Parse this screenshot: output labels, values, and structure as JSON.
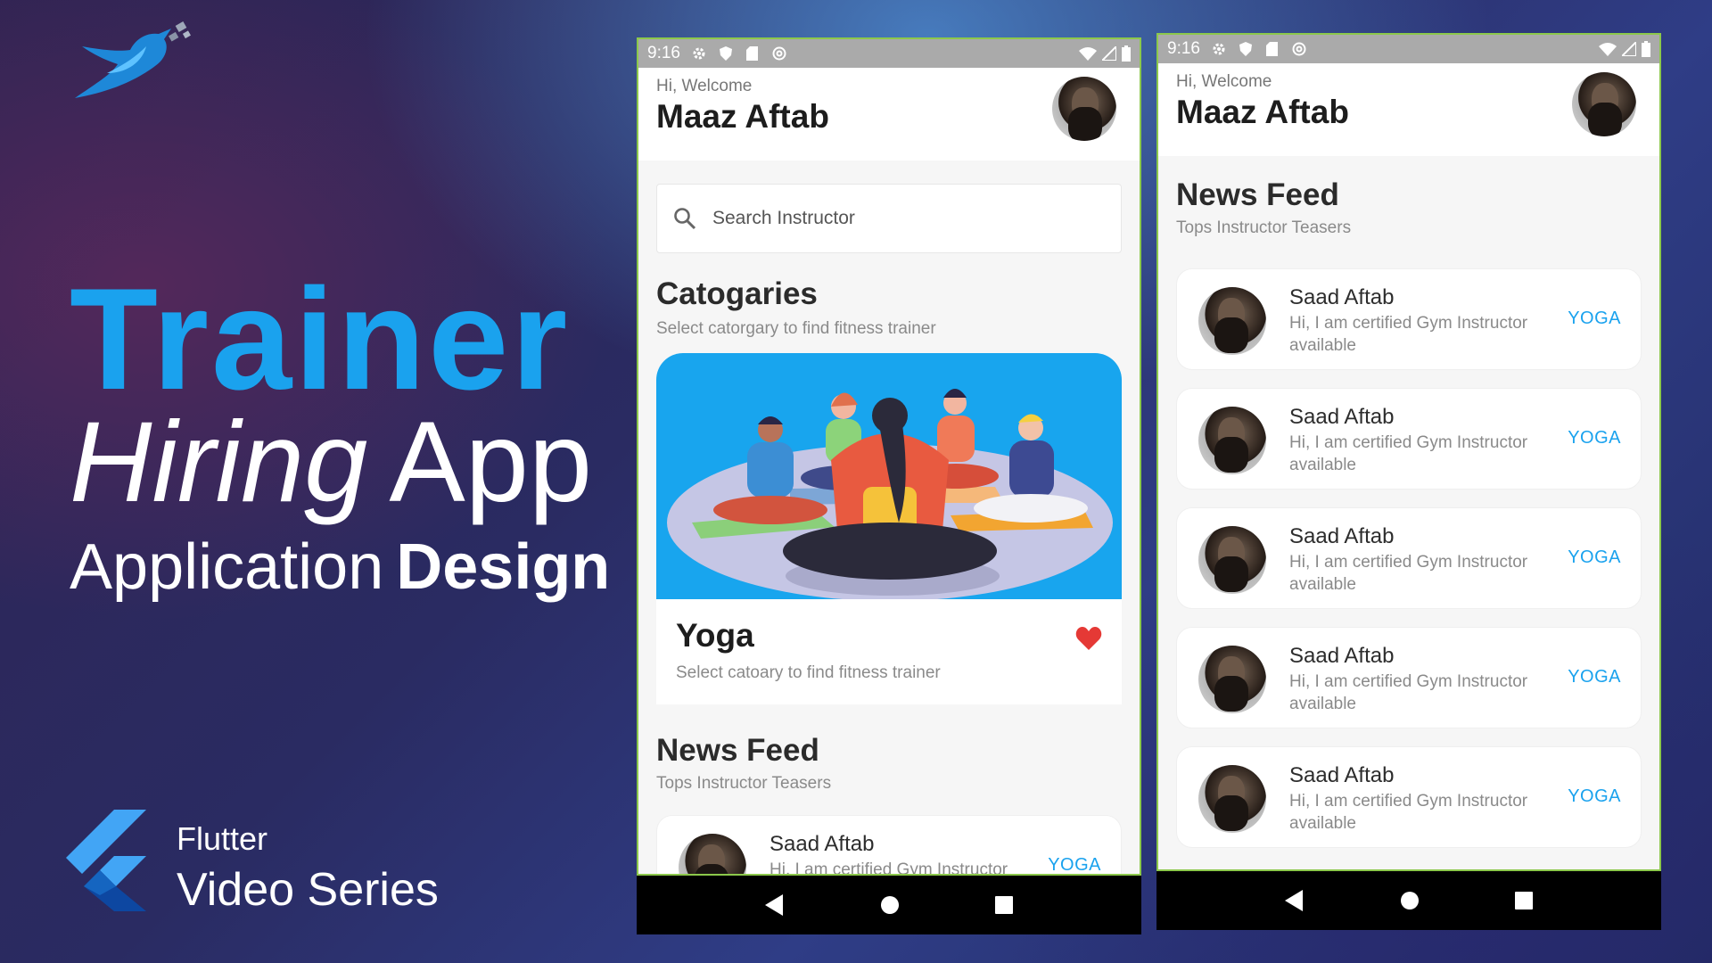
{
  "branding": {
    "title_word1": "Trainer",
    "title_word2": "Hiring",
    "title_word3": "App",
    "subtitle_light": "Application",
    "subtitle_bold": "Design",
    "series_title": "Flutter",
    "series_subtitle": "Video Series"
  },
  "colors": {
    "accent": "#1aa2ee",
    "heart": "#e53935",
    "frame": "#8cc84b"
  },
  "status_bar": {
    "time": "9:16",
    "icons": [
      "gear-icon",
      "shield-icon",
      "sd-card-icon",
      "at-sign-icon"
    ],
    "right_icons": [
      "wifi-icon",
      "signal-icon",
      "battery-icon"
    ]
  },
  "nav_bar": {
    "buttons": [
      "back-icon",
      "home-icon",
      "recents-icon"
    ]
  },
  "phone_home": {
    "greeting": "Hi, Welcome",
    "user_name": "Maaz Aftab",
    "search": {
      "placeholder": "Search Instructor"
    },
    "categories": {
      "title": "Catogaries",
      "subtitle": "Select catorgary to find fitness trainer",
      "card": {
        "title": "Yoga",
        "subtitle": "Select catoary to find fitness trainer",
        "favorited": true
      }
    },
    "news_feed": {
      "title": "News Feed",
      "subtitle": "Tops Instructor Teasers",
      "items": [
        {
          "name": "Saad Aftab",
          "description": "Hi, I am certified Gym Instructor",
          "tag": "YOGA"
        }
      ]
    }
  },
  "phone_feed": {
    "greeting": "Hi, Welcome",
    "user_name": "Maaz Aftab",
    "news_feed": {
      "title": "News Feed",
      "subtitle": "Tops Instructor Teasers",
      "items": [
        {
          "name": "Saad Aftab",
          "description": "Hi, I am certified Gym Instructor available",
          "tag": "YOGA"
        },
        {
          "name": "Saad Aftab",
          "description": "Hi, I am certified Gym Instructor available",
          "tag": "YOGA"
        },
        {
          "name": "Saad Aftab",
          "description": "Hi, I am certified Gym Instructor available",
          "tag": "YOGA"
        },
        {
          "name": "Saad Aftab",
          "description": "Hi, I am certified Gym Instructor available",
          "tag": "YOGA"
        },
        {
          "name": "Saad Aftab",
          "description": "Hi, I am certified Gym Instructor available",
          "tag": "YOGA"
        }
      ]
    }
  }
}
